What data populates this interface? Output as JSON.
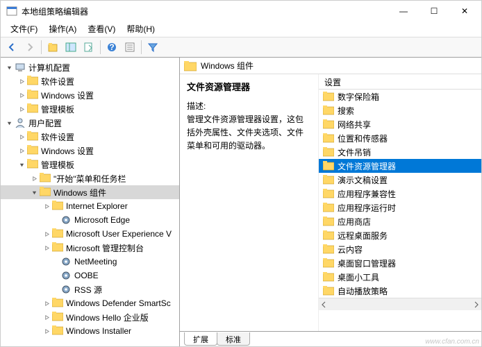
{
  "window": {
    "title": "本地组策略编辑器",
    "controls": {
      "min": "—",
      "max": "☐",
      "close": "✕"
    }
  },
  "menu": {
    "file": "文件(F)",
    "action": "操作(A)",
    "view": "查看(V)",
    "help": "帮助(H)"
  },
  "tree": {
    "root1": "计算机配置",
    "r1a": "软件设置",
    "r1b": "Windows 设置",
    "r1c": "管理模板",
    "root2": "用户配置",
    "r2a": "软件设置",
    "r2b": "Windows 设置",
    "r2c": "管理模板",
    "start": "\"开始\"菜单和任务栏",
    "win": "Windows 组件",
    "ie": "Internet Explorer",
    "edge": "Microsoft Edge",
    "mue": "Microsoft User Experience V",
    "mmc": "Microsoft 管理控制台",
    "nm": "NetMeeting",
    "oobe": "OOBE",
    "rss": "RSS 源",
    "wds": "Windows Defender SmartSc",
    "whe": "Windows Hello 企业版",
    "wi": "Windows Installer"
  },
  "right": {
    "header": "Windows 组件",
    "title": "文件资源管理器",
    "descLabel": "描述:",
    "desc": "管理文件资源管理器设置，这包括外壳属性、文件夹选项、文件菜单和可用的驱动器。",
    "listHeader": "设置",
    "items": [
      "数字保险箱",
      "搜索",
      "网络共享",
      "位置和传感器",
      "文件吊销",
      "文件资源管理器",
      "演示文稿设置",
      "应用程序兼容性",
      "应用程序运行时",
      "应用商店",
      "远程桌面服务",
      "云内容",
      "桌面窗口管理器",
      "桌面小工具",
      "自动播放策略"
    ],
    "selectedIndex": 5
  },
  "tabs": {
    "ext": "扩展",
    "std": "标准"
  },
  "watermark": "www.cfan.com.cn"
}
